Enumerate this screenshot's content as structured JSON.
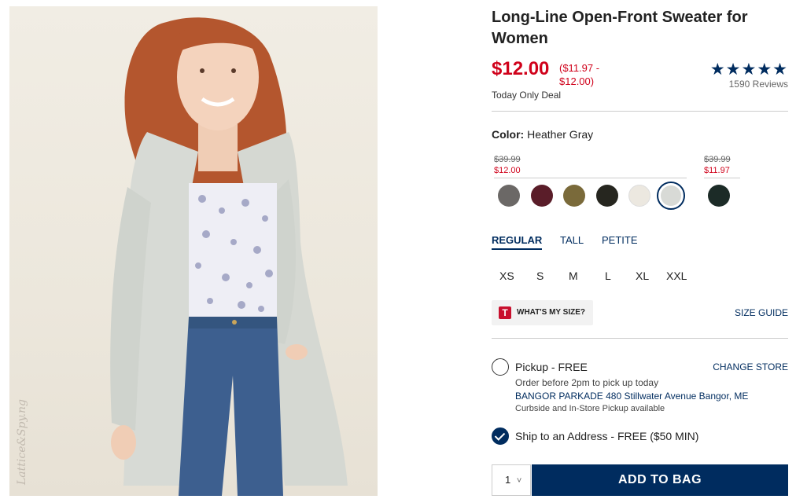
{
  "product": {
    "title": "Long-Line Open-Front Sweater for Women",
    "price": "$12.00",
    "price_range": "($11.97 - $12.00)",
    "deal": "Today Only Deal",
    "rating_stars": "★★★★★",
    "rating": 5,
    "reviews": "1590 Reviews",
    "watermark": "Lattice&Spy.ng"
  },
  "color": {
    "label": "Color:",
    "value": "Heather Gray",
    "groups": [
      {
        "old_price": "$39.99",
        "new_price": "$12.00"
      },
      {
        "old_price": "$39.99",
        "new_price": "$11.97"
      }
    ],
    "swatches": [
      {
        "name": "charcoal",
        "hex": "#6b6866"
      },
      {
        "name": "burgundy",
        "hex": "#5a1d29"
      },
      {
        "name": "olive",
        "hex": "#7a6a3a"
      },
      {
        "name": "black",
        "hex": "#26261f"
      },
      {
        "name": "cream",
        "hex": "#ece8e0"
      },
      {
        "name": "heather-gray",
        "hex": "#d8dad6",
        "selected": true
      },
      {
        "name": "dark-green",
        "hex": "#1c2b27"
      }
    ]
  },
  "fit": {
    "tabs": [
      "REGULAR",
      "TALL",
      "PETITE"
    ],
    "active": "REGULAR"
  },
  "sizes": [
    "XS",
    "S",
    "M",
    "L",
    "XL",
    "XXL"
  ],
  "size_help": {
    "badge": "T",
    "label": "WHAT'S MY SIZE?",
    "guide": "SIZE GUIDE"
  },
  "fulfillment": {
    "pickup_label": "Pickup - FREE",
    "change_store": "CHANGE STORE",
    "pickup_info": "Order before 2pm to pick up today",
    "store": "BANGOR PARKADE 480 Stillwater Avenue  Bangor, ME",
    "curbside": "Curbside and In-Store Pickup available",
    "ship_label": "Ship to an Address - FREE ($50 MIN)",
    "ship_selected": true
  },
  "cart": {
    "quantity": "1",
    "chevron": "˅",
    "add_label": "ADD TO BAG"
  },
  "colors": {
    "brand_navy": "#002c5f",
    "sale_red": "#d0021b"
  }
}
